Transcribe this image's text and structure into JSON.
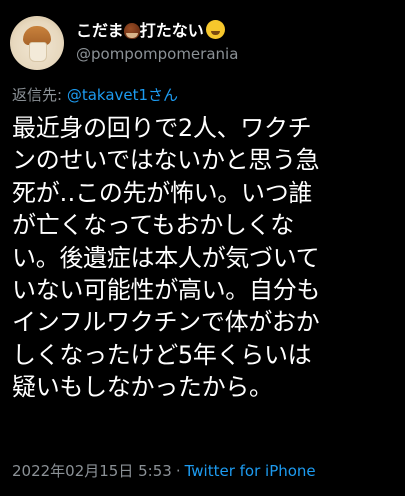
{
  "author": {
    "display_name": "こだま",
    "display_name_suffix": "打たない",
    "handle": "@pompompomerania",
    "avatar_icon": "mushroom-avatar-icon",
    "emoji_1": "chestnut-emoji-icon",
    "emoji_2": "hugging-face-emoji-icon"
  },
  "reply": {
    "prefix": "返信先: ",
    "mention": "@takavet1さん"
  },
  "tweet": {
    "lines": [
      "最近身の回りで2人、ワクチ",
      "ンのせいではないかと思う急",
      "死が‥この先が怖い。いつ誰",
      "が亡くなってもおかしくな",
      "い。後遺症は本人が気づいて",
      "いない可能性が高い。自分も",
      "インフルワクチンで体がおか",
      "しくなったけど5年くらいは",
      "疑いもしなかったから。"
    ]
  },
  "meta": {
    "timestamp": "2022年02月15日 5:53",
    "separator": "·",
    "source": "Twitter for iPhone"
  },
  "colors": {
    "background": "#000000",
    "text": "#ffffff",
    "secondary": "#8b9196",
    "link": "#1d9bf0"
  }
}
